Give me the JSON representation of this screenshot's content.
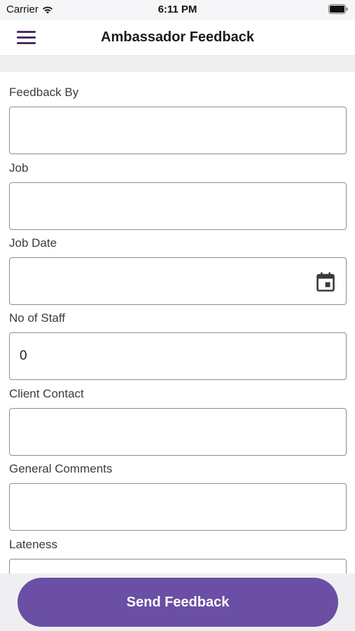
{
  "status_bar": {
    "carrier": "Carrier",
    "time": "6:11 PM",
    "wifi_icon": "wifi-icon",
    "battery_icon": "battery-icon"
  },
  "nav": {
    "title": "Ambassador Feedback",
    "menu_icon": "hamburger-menu-icon"
  },
  "form": {
    "fields": [
      {
        "label": "Feedback By",
        "value": ""
      },
      {
        "label": "Job",
        "value": ""
      },
      {
        "label": "Job Date",
        "value": "",
        "icon": "calendar-icon"
      },
      {
        "label": "No of Staff",
        "value": "0"
      },
      {
        "label": "Client Contact",
        "value": ""
      },
      {
        "label": "General Comments",
        "value": ""
      },
      {
        "label": "Lateness",
        "value": ""
      }
    ]
  },
  "actions": {
    "send_label": "Send Feedback"
  },
  "colors": {
    "accent": "#6a4fa4",
    "menu_icon": "#4a2d63",
    "field_border": "#8e8e93"
  }
}
